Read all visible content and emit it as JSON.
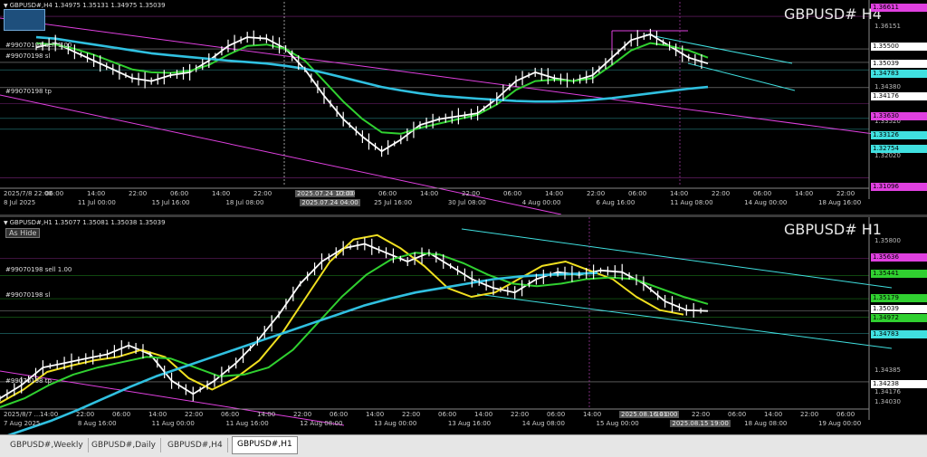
{
  "chart_data": [
    {
      "type": "line",
      "symbol": "GBPUSD# H4",
      "ohlc": "GBPUSD#,H4  1.34975 1.35131 1.34975 1.35039",
      "y_ticks": [
        "1.36151",
        "1.35500",
        "1.34380",
        "1.33520",
        "1.32020"
      ],
      "price_badges": [
        {
          "value": "1.36611",
          "color": "#e040e0"
        },
        {
          "value": "1.35500",
          "color": "#ffffff"
        },
        {
          "value": "1.35039",
          "color": "#ffffff"
        },
        {
          "value": "1.34783",
          "color": "#40e0e0"
        },
        {
          "value": "1.34176",
          "color": "#ffffff"
        },
        {
          "value": "1.33630",
          "color": "#e040e0"
        },
        {
          "value": "1.33126",
          "color": "#40e0e0"
        },
        {
          "value": "1.32754",
          "color": "#40e0e0"
        },
        {
          "value": "1.31096",
          "color": "#e040e0"
        }
      ],
      "line_labels": [
        "#99070198 sell 1.00",
        "#99070198 sl",
        "#99070198 tp"
      ],
      "x_ticks": [
        "2025/7/8 22:00",
        "06:00",
        "14:00",
        "22:00",
        "06:00",
        "14:00",
        "22:00",
        "2025.07.24 10:00",
        "22:00",
        "06:00",
        "14:00",
        "22:00",
        "06:00",
        "14:00",
        "22:00",
        "06:00",
        "14:00",
        "22:00",
        "06:00",
        "14:00",
        "22:00"
      ],
      "x_ticks_lower": [
        "8 Jul 2025",
        "11 Jul 00:00",
        "15 Jul 16:00",
        "18 Jul 08:00",
        "2025.07.24 04:00",
        "25 Jul 16:00",
        "30 Jul 08:00",
        "4 Aug 00:00",
        "6 Aug 16:00",
        "11 Aug 08:00",
        "14 Aug 00:00",
        "18 Aug 16:00"
      ],
      "series": [
        {
          "name": "price",
          "color": "#ffffff",
          "values": [
            1.3555,
            1.357,
            1.354,
            1.351,
            1.348,
            1.345,
            1.344,
            1.346,
            1.347,
            1.351,
            1.356,
            1.359,
            1.3585,
            1.355,
            1.348,
            1.339,
            1.331,
            1.325,
            1.32,
            1.324,
            1.329,
            1.331,
            1.332,
            1.333,
            1.338,
            1.344,
            1.347,
            1.345,
            1.344,
            1.346,
            1.352,
            1.358,
            1.36,
            1.356,
            1.352,
            1.35
          ]
        },
        {
          "name": "ma_green",
          "color": "#30d030",
          "values": [
            1.357,
            1.3565,
            1.355,
            1.353,
            1.3505,
            1.348,
            1.347,
            1.3468,
            1.3475,
            1.3495,
            1.353,
            1.356,
            1.3565,
            1.355,
            1.351,
            1.344,
            1.337,
            1.331,
            1.3265,
            1.326,
            1.328,
            1.3295,
            1.331,
            1.3325,
            1.336,
            1.341,
            1.344,
            1.3445,
            1.344,
            1.345,
            1.3495,
            1.3545,
            1.357,
            1.356,
            1.3545,
            1.352
          ]
        },
        {
          "name": "ma_cyan",
          "color": "#30c0e0",
          "values": [
            1.359,
            1.3585,
            1.3575,
            1.3565,
            1.3555,
            1.3545,
            1.3535,
            1.3528,
            1.3522,
            1.3516,
            1.351,
            1.3505,
            1.35,
            1.3492,
            1.3482,
            1.3468,
            1.3452,
            1.3436,
            1.342,
            1.3408,
            1.3398,
            1.339,
            1.3385,
            1.338,
            1.3376,
            1.3372,
            1.337,
            1.337,
            1.3372,
            1.3376,
            1.3382,
            1.339,
            1.3398,
            1.3406,
            1.3414,
            1.342
          ]
        }
      ],
      "ylim": [
        1.308,
        1.368
      ]
    },
    {
      "type": "line",
      "symbol": "GBPUSD# H1",
      "ohlc": "GBPUSD#,H1  1.35077 1.35081 1.35038 1.35039",
      "y_ticks": [
        "1.35800",
        "1.34385",
        "1.34030"
      ],
      "price_badges": [
        {
          "value": "1.35636",
          "color": "#e040e0"
        },
        {
          "value": "1.35441",
          "color": "#30d030"
        },
        {
          "value": "1.35179",
          "color": "#30d030"
        },
        {
          "value": "1.35039",
          "color": "#ffffff"
        },
        {
          "value": "1.34972",
          "color": "#30d030"
        },
        {
          "value": "1.34783",
          "color": "#40e0e0"
        },
        {
          "value": "1.34238",
          "color": "#ffffff"
        }
      ],
      "line_labels": [
        "#99070198 sell 1.00",
        "#99070198 sl",
        "#99070198 tp"
      ],
      "extra_price_labels": [
        "1.34176"
      ],
      "x_ticks": [
        "2025/8/7 ...",
        "14:00",
        "22:00",
        "06:00",
        "14:00",
        "22:00",
        "06:00",
        "14:00",
        "22:00",
        "06:00",
        "14:00",
        "22:00",
        "06:00",
        "14:00",
        "22:00",
        "06:00",
        "14:00",
        "2025.08.16 01:00",
        "14:00",
        "22:00",
        "06:00",
        "14:00",
        "22:00",
        "06:00"
      ],
      "x_ticks_lower": [
        "7 Aug 2025",
        "8 Aug 16:00",
        "11 Aug 00:00",
        "11 Aug 16:00",
        "12 Aug 08:00",
        "13 Aug 00:00",
        "13 Aug 16:00",
        "14 Aug 08:00",
        "15 Aug 00:00",
        "2025.08.15 19:00",
        "18 Aug 08:00",
        "19 Aug 00:00"
      ],
      "series": [
        {
          "name": "price",
          "color": "#ffffff",
          "values": [
            1.3405,
            1.342,
            1.344,
            1.3445,
            1.345,
            1.3455,
            1.3465,
            1.3455,
            1.3425,
            1.341,
            1.3425,
            1.3445,
            1.347,
            1.35,
            1.3535,
            1.356,
            1.3575,
            1.358,
            1.357,
            1.356,
            1.357,
            1.3555,
            1.354,
            1.353,
            1.3525,
            1.354,
            1.3548,
            1.3545,
            1.355,
            1.3548,
            1.3535,
            1.3515,
            1.3505,
            1.3504
          ]
        },
        {
          "name": "ma_yellow",
          "color": "#f0e020",
          "values": [
            1.34,
            1.3415,
            1.3435,
            1.3442,
            1.3448,
            1.3452,
            1.346,
            1.3452,
            1.3428,
            1.3415,
            1.3428,
            1.3448,
            1.348,
            1.352,
            1.356,
            1.3585,
            1.359,
            1.3575,
            1.3555,
            1.353,
            1.352,
            1.3525,
            1.354,
            1.3555,
            1.356,
            1.355,
            1.354,
            1.352,
            1.3505,
            1.35
          ]
        },
        {
          "name": "ma_green",
          "color": "#30d030",
          "values": [
            1.3395,
            1.3405,
            1.342,
            1.3432,
            1.344,
            1.3446,
            1.3452,
            1.345,
            1.344,
            1.343,
            1.3432,
            1.344,
            1.346,
            1.349,
            1.352,
            1.3545,
            1.3562,
            1.357,
            1.3568,
            1.3558,
            1.3545,
            1.3535,
            1.3532,
            1.3535,
            1.354,
            1.3542,
            1.354,
            1.353,
            1.352,
            1.3512
          ]
        },
        {
          "name": "ma_cyan",
          "color": "#30c0e0",
          "values": [
            1.336,
            1.337,
            1.338,
            1.3392,
            1.3405,
            1.3418,
            1.343,
            1.344,
            1.345,
            1.346,
            1.347,
            1.348,
            1.349,
            1.35,
            1.351,
            1.3518,
            1.3525,
            1.353,
            1.3535,
            1.354,
            1.3543,
            1.3545,
            1.3546,
            1.3547
          ]
        }
      ],
      "ylim": [
        1.3395,
        1.36
      ]
    }
  ],
  "tabs": [
    "GBPUSD#,Weekly",
    "GBPUSD#,Daily",
    "GBPUSD#,H4",
    "GBPUSD#,H1"
  ],
  "active_tab": "GBPUSD#,H1",
  "hide_button": "As Hide",
  "colors": {
    "magenta": "#e040e0",
    "cyan": "#40e0e0",
    "green": "#30d030",
    "white": "#ffffff",
    "yellow": "#f0e020"
  }
}
